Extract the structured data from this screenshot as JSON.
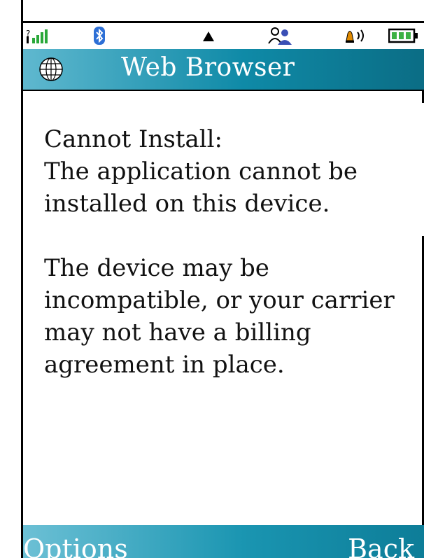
{
  "status_bar": {
    "icons": [
      "signal-strength-icon",
      "bluetooth-icon",
      "roaming-indicator-icon",
      "contacts-icon",
      "ringer-volume-icon",
      "battery-icon"
    ]
  },
  "title_bar": {
    "icon": "globe-icon",
    "title": "Web Browser"
  },
  "message": {
    "heading": "Cannot Install:",
    "line": "The application cannot be installed on this device.",
    "detail": "The device may be incompatible, or your carrier may not have a billing agreement in place."
  },
  "softkeys": {
    "left": "Options",
    "right": "Back"
  },
  "colors": {
    "accent": "#0f8aa7",
    "accent_light": "#5fb8cf",
    "signal_green": "#2aa83a",
    "bluetooth_blue": "#2d6fd6",
    "battery_green": "#3cb043"
  }
}
